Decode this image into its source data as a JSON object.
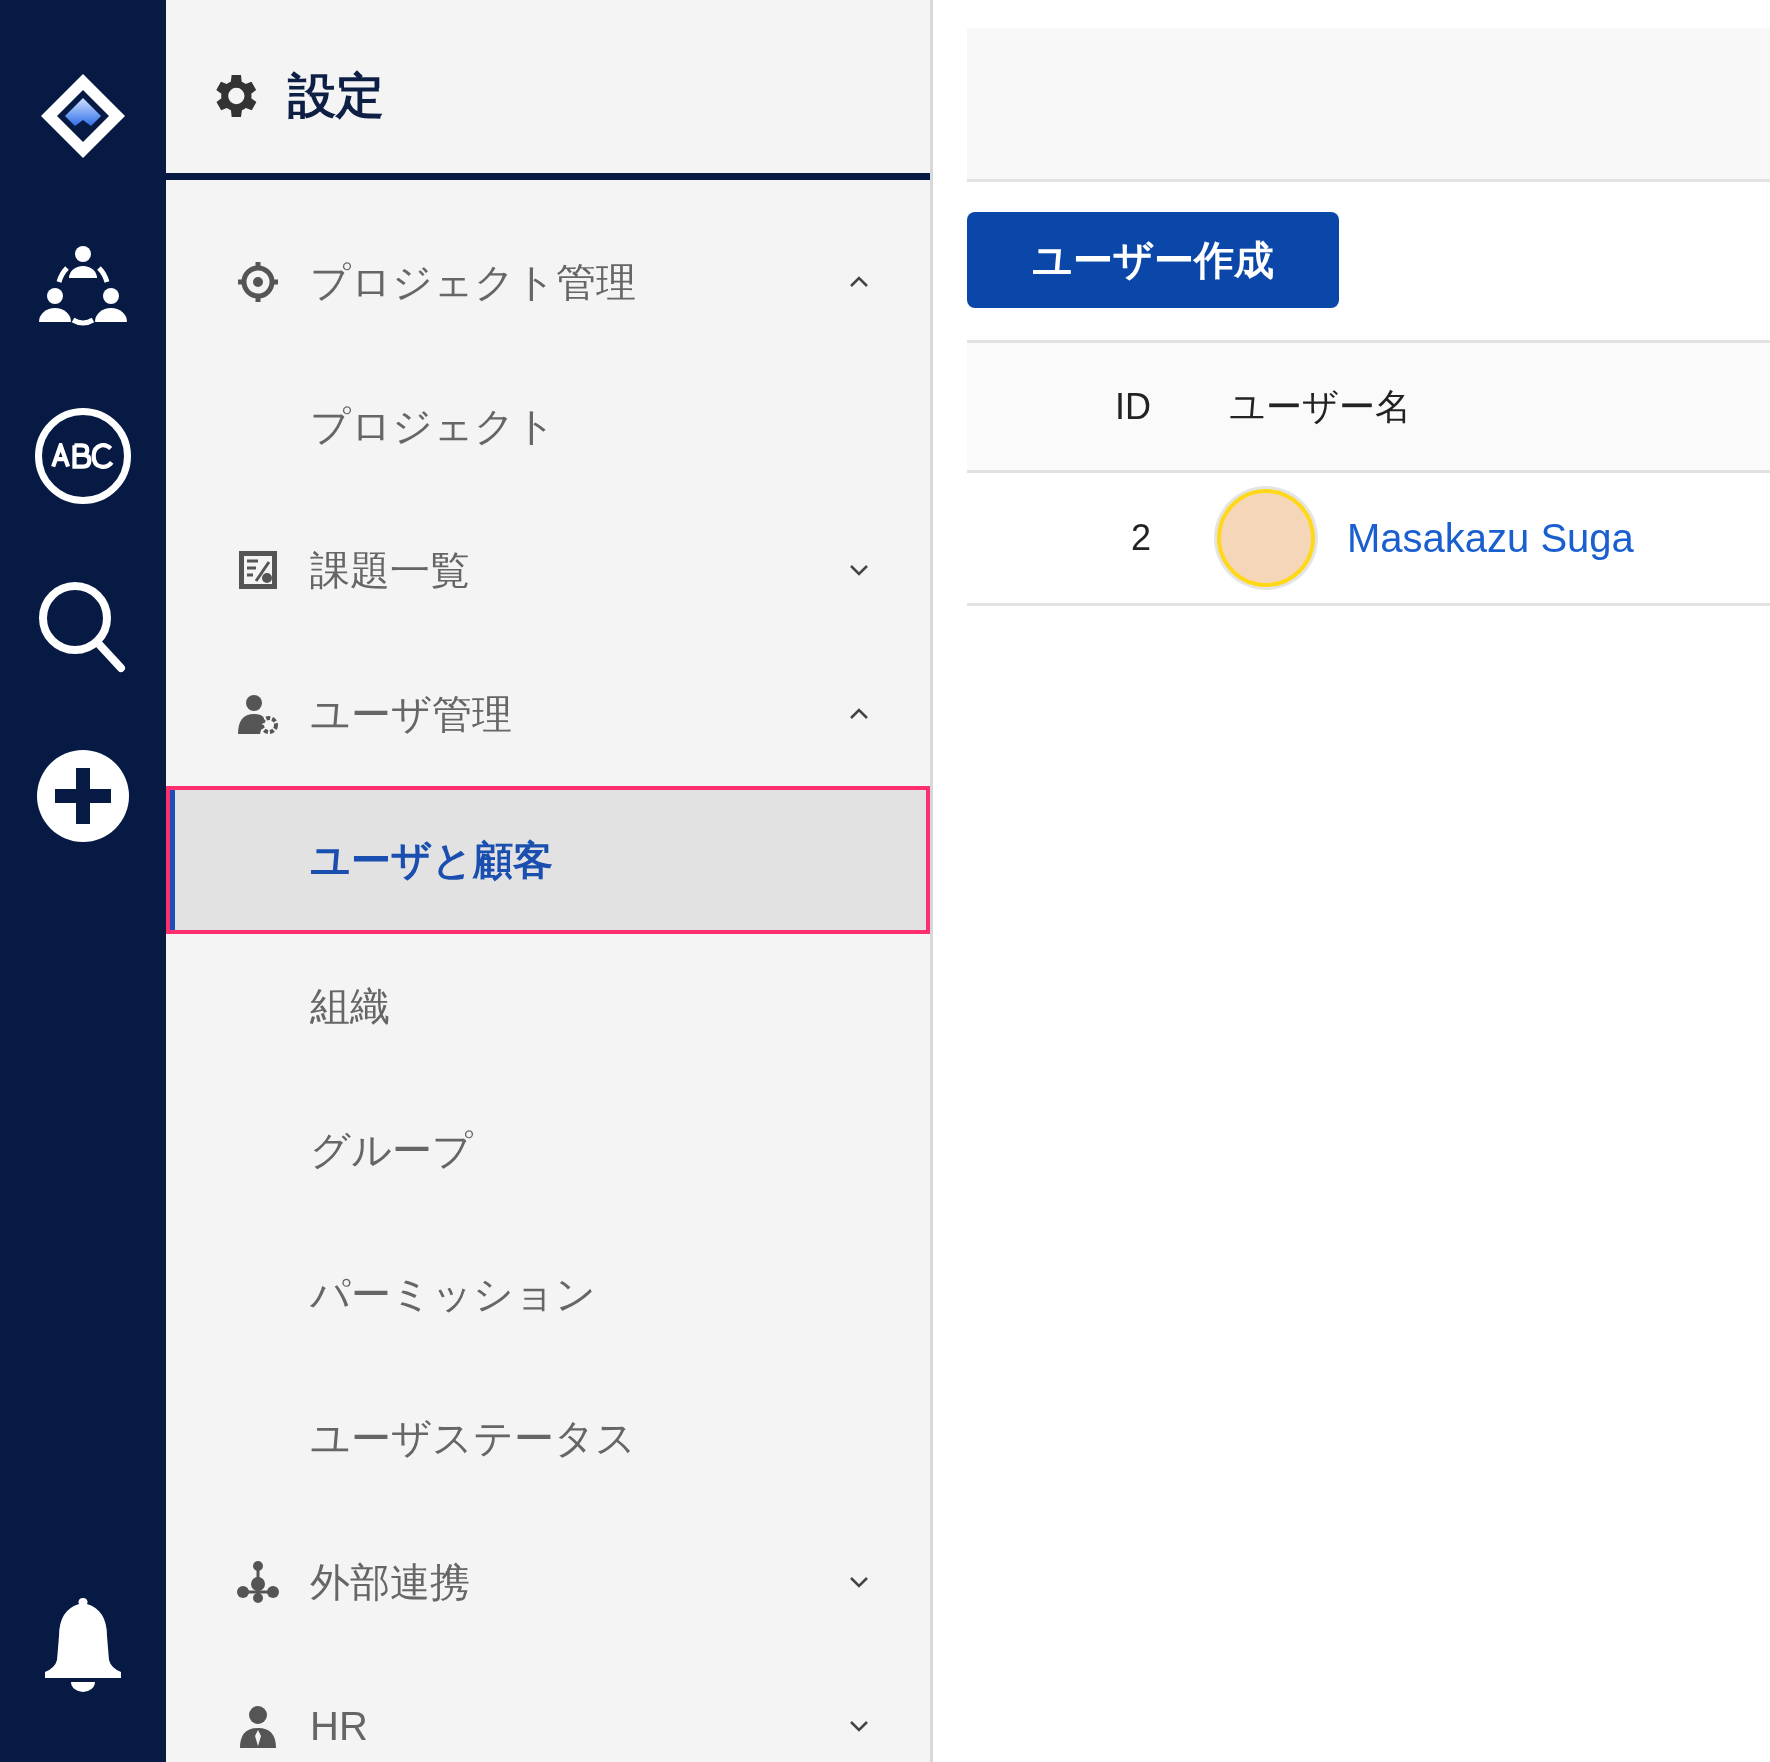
{
  "settings_panel": {
    "title": "設定"
  },
  "menu": [
    {
      "label": "プロジェクト管理",
      "expanded": true,
      "children": [
        {
          "label": "プロジェクト",
          "selected": false
        }
      ]
    },
    {
      "label": "課題一覧",
      "expanded": false
    },
    {
      "label": "ユーザ管理",
      "expanded": true,
      "children": [
        {
          "label": "ユーザと顧客",
          "selected": true
        },
        {
          "label": "組織",
          "selected": false
        },
        {
          "label": "グループ",
          "selected": false
        },
        {
          "label": "パーミッション",
          "selected": false
        },
        {
          "label": "ユーザステータス",
          "selected": false
        }
      ]
    },
    {
      "label": "外部連携",
      "expanded": false
    },
    {
      "label": "HR",
      "expanded": false
    }
  ],
  "create_button": "ユーザー作成",
  "table": {
    "columns": [
      "ID",
      "ユーザー名"
    ],
    "rows": [
      {
        "id": "2",
        "name": "Masakazu Suga"
      }
    ]
  }
}
